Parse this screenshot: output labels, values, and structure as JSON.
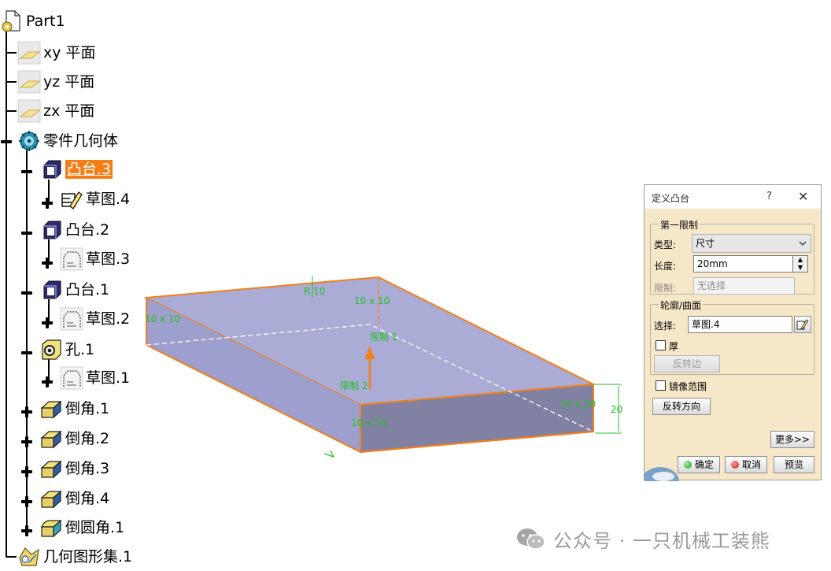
{
  "tree": {
    "root": "Part1",
    "items": [
      {
        "label": "xy 平面",
        "icon": "plane-icon"
      },
      {
        "label": "yz 平面",
        "icon": "plane-icon"
      },
      {
        "label": "zx 平面",
        "icon": "plane-icon"
      },
      {
        "label": "零件几何体",
        "icon": "part-body-icon"
      },
      {
        "label": "凸台.3",
        "icon": "pad-icon",
        "selected": true
      },
      {
        "label": "草图.4",
        "icon": "sketch-active-icon"
      },
      {
        "label": "凸台.2",
        "icon": "pad-icon"
      },
      {
        "label": "草图.3",
        "icon": "sketch-icon"
      },
      {
        "label": "凸台.1",
        "icon": "pad-icon"
      },
      {
        "label": "草图.2",
        "icon": "sketch-icon"
      },
      {
        "label": "孔.1",
        "icon": "hole-icon"
      },
      {
        "label": "草图.1",
        "icon": "sketch-icon"
      },
      {
        "label": "倒角.1",
        "icon": "chamfer-icon"
      },
      {
        "label": "倒角.2",
        "icon": "chamfer-icon"
      },
      {
        "label": "倒角.3",
        "icon": "chamfer-icon"
      },
      {
        "label": "倒角.4",
        "icon": "chamfer-icon"
      },
      {
        "label": "倒圆角.1",
        "icon": "fillet-icon"
      },
      {
        "label": "几何图形集.1",
        "icon": "geometrical-set-icon"
      }
    ]
  },
  "viewport": {
    "annotations": {
      "r10": "R 10",
      "top_dim": "10 x 10",
      "left_dim": "10 x 10",
      "front_dim": "10 x 10",
      "right_dim": "10 x 10",
      "height": "20",
      "limit1": "限制 1",
      "limit2": "限制 2"
    },
    "colors": {
      "face_top": "#abacd6",
      "face_front": "#8181a3",
      "edge": "#f37f1a",
      "annotation": "#1fc21f"
    }
  },
  "dialog": {
    "title": "定义凸台",
    "help": "?",
    "close": "✕",
    "first_limit": {
      "legend": "第一限制",
      "type_label": "类型:",
      "type_value": "尺寸",
      "length_label": "长度:",
      "length_value": "20mm",
      "limit_label": "限制:",
      "limit_placeholder": "无选择"
    },
    "profile": {
      "legend": "轮廓/曲面",
      "select_label": "选择:",
      "select_value": "草图.4",
      "thick_label": "厚",
      "reverse_side": "反转边"
    },
    "mirror_label": "镜像范围",
    "reverse_direction": "反转方向",
    "more": "更多>>",
    "ok": "确定",
    "cancel": "取消",
    "preview": "预览"
  },
  "watermark": "公众号 · 一只机械工装熊"
}
